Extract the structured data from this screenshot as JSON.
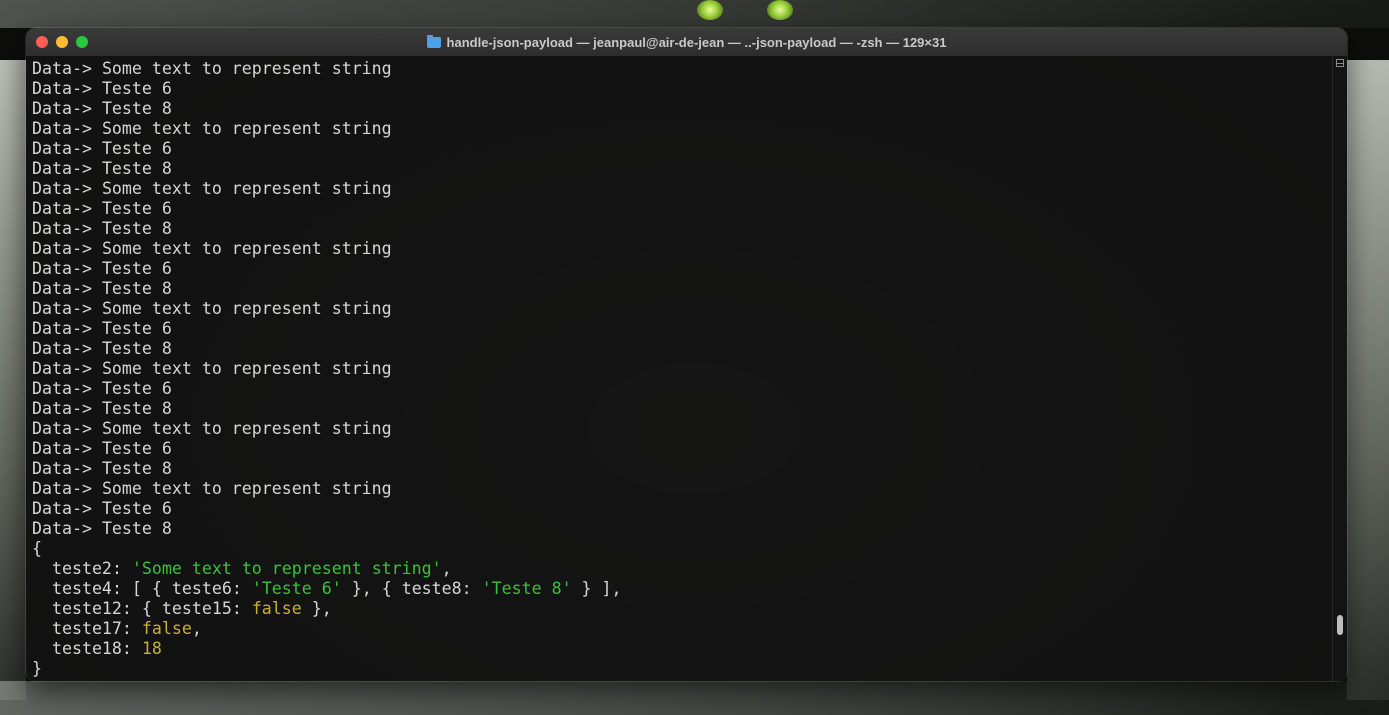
{
  "window": {
    "title": "handle-json-payload — jeanpaul@air-de-jean — ..-json-payload — -zsh — 129×31",
    "folder_icon": "folder-icon"
  },
  "terminal": {
    "prompt_prefix": "Data-> ",
    "log_lines": [
      "Some text to represent string",
      "Teste 6",
      "Teste 8",
      "Some text to represent string",
      "Teste 6",
      "Teste 8",
      "Some text to represent string",
      "Teste 6",
      "Teste 8",
      "Some text to represent string",
      "Teste 6",
      "Teste 8",
      "Some text to represent string",
      "Teste 6",
      "Teste 8",
      "Some text to represent string",
      "Teste 6",
      "Teste 8",
      "Some text to represent string",
      "Teste 6",
      "Teste 8",
      "Some text to represent string",
      "Teste 6",
      "Teste 8"
    ],
    "object_open": "{",
    "object_close": "}",
    "object": {
      "teste2_key": "teste2",
      "teste2_value": "'Some text to represent string'",
      "teste4_key": "teste4",
      "teste6_key": "teste6",
      "teste6_value": "'Teste 6'",
      "teste8_key": "teste8",
      "teste8_value": "'Teste 8'",
      "teste12_key": "teste12",
      "teste15_key": "teste15",
      "teste15_value": "false",
      "teste17_key": "teste17",
      "teste17_value": "false",
      "teste18_key": "teste18",
      "teste18_value": "18"
    }
  },
  "colors": {
    "string": "#3cc03c",
    "keyword": "#c8b22a",
    "text": "#d6d6d6"
  }
}
